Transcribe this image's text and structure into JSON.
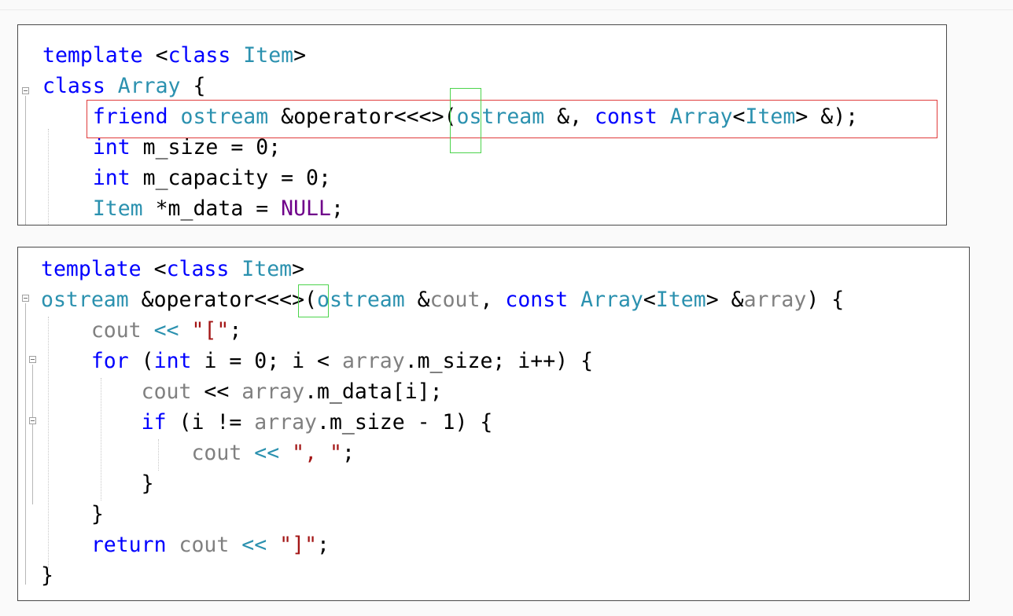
{
  "snippet1": {
    "lines": [
      [
        {
          "t": "template ",
          "c": "kw"
        },
        {
          "t": "<",
          "c": "pl"
        },
        {
          "t": "class ",
          "c": "kw"
        },
        {
          "t": "Item",
          "c": "ty"
        },
        {
          "t": ">",
          "c": "pl"
        }
      ],
      [
        {
          "t": "class ",
          "c": "kw"
        },
        {
          "t": "Array",
          "c": "ty"
        },
        {
          "t": " {",
          "c": "pl"
        }
      ],
      [
        {
          "t": "    friend ",
          "c": "kw"
        },
        {
          "t": "ostream",
          "c": "ty"
        },
        {
          "t": " &operator<<<>(",
          "c": "pl"
        },
        {
          "t": "ostream",
          "c": "ty"
        },
        {
          "t": " &, ",
          "c": "pl"
        },
        {
          "t": "const ",
          "c": "kw"
        },
        {
          "t": "Array",
          "c": "ty"
        },
        {
          "t": "<",
          "c": "pl"
        },
        {
          "t": "Item",
          "c": "ty"
        },
        {
          "t": "> &);",
          "c": "pl"
        }
      ],
      [
        {
          "t": "    int ",
          "c": "kw"
        },
        {
          "t": "m_size = 0;",
          "c": "pl"
        }
      ],
      [
        {
          "t": "    int ",
          "c": "kw"
        },
        {
          "t": "m_capacity = 0;",
          "c": "pl"
        }
      ],
      [
        {
          "t": "    Item",
          "c": "ty"
        },
        {
          "t": " *m_data = ",
          "c": "pl"
        },
        {
          "t": "NULL",
          "c": "ma"
        },
        {
          "t": ";",
          "c": "pl"
        }
      ]
    ]
  },
  "snippet2": {
    "lines": [
      [
        {
          "t": "template ",
          "c": "kw"
        },
        {
          "t": "<",
          "c": "pl"
        },
        {
          "t": "class ",
          "c": "kw"
        },
        {
          "t": "Item",
          "c": "ty"
        },
        {
          "t": ">",
          "c": "pl"
        }
      ],
      [
        {
          "t": "ostream",
          "c": "ty"
        },
        {
          "t": " &operator<<<>(",
          "c": "pl"
        },
        {
          "t": "ostream",
          "c": "ty"
        },
        {
          "t": " &",
          "c": "pl"
        },
        {
          "t": "cout",
          "c": "gr"
        },
        {
          "t": ", ",
          "c": "pl"
        },
        {
          "t": "const ",
          "c": "kw"
        },
        {
          "t": "Array",
          "c": "ty"
        },
        {
          "t": "<",
          "c": "pl"
        },
        {
          "t": "Item",
          "c": "ty"
        },
        {
          "t": "> &",
          "c": "pl"
        },
        {
          "t": "array",
          "c": "gr"
        },
        {
          "t": ") {",
          "c": "pl"
        }
      ],
      [
        {
          "t": "    cout",
          "c": "gr"
        },
        {
          "t": " << ",
          "c": "ty"
        },
        {
          "t": "\"[\"",
          "c": "st"
        },
        {
          "t": ";",
          "c": "pl"
        }
      ],
      [
        {
          "t": "    for ",
          "c": "kw"
        },
        {
          "t": "(",
          "c": "pl"
        },
        {
          "t": "int ",
          "c": "kw"
        },
        {
          "t": "i = 0; i < ",
          "c": "pl"
        },
        {
          "t": "array",
          "c": "gr"
        },
        {
          "t": ".m_size; i++) {",
          "c": "pl"
        }
      ],
      [
        {
          "t": "        cout",
          "c": "gr"
        },
        {
          "t": " << ",
          "c": "pl"
        },
        {
          "t": "array",
          "c": "gr"
        },
        {
          "t": ".m_data[i];",
          "c": "pl"
        }
      ],
      [
        {
          "t": "        if ",
          "c": "kw"
        },
        {
          "t": "(i != ",
          "c": "pl"
        },
        {
          "t": "array",
          "c": "gr"
        },
        {
          "t": ".m_size - 1) {",
          "c": "pl"
        }
      ],
      [
        {
          "t": "            cout",
          "c": "gr"
        },
        {
          "t": " << ",
          "c": "ty"
        },
        {
          "t": "\", \"",
          "c": "st"
        },
        {
          "t": ";",
          "c": "pl"
        }
      ],
      [
        {
          "t": "        }",
          "c": "pl"
        }
      ],
      [
        {
          "t": "    }",
          "c": "pl"
        }
      ],
      [
        {
          "t": "    return ",
          "c": "kw"
        },
        {
          "t": "cout",
          "c": "gr"
        },
        {
          "t": " << ",
          "c": "ty"
        },
        {
          "t": "\"]\"",
          "c": "st"
        },
        {
          "t": ";",
          "c": "pl"
        }
      ],
      [
        {
          "t": "}",
          "c": "pl"
        }
      ]
    ]
  }
}
